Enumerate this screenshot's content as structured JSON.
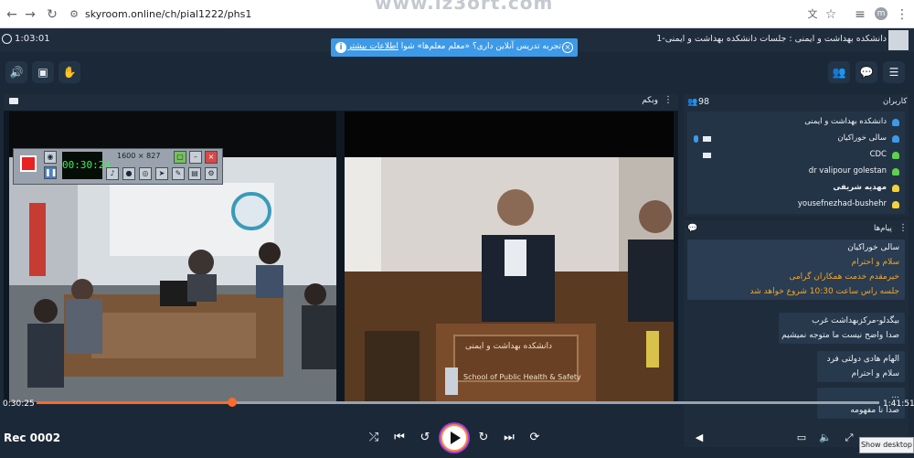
{
  "browser": {
    "url": "skyroom.online/ch/pial1222/phs1",
    "watermark": "www.lz3ort.com",
    "profile_initial": "m"
  },
  "app": {
    "timer": "1:03:01",
    "notice": {
      "text": "تجربه تدریس آنلاین داری؟ «معلم معلم‌ها» شوا",
      "link": "اطلاعات بیشتر"
    },
    "room_title": "دانشکده بهداشت و ایمنی : جلسات دانشکده بهداشت و ایمنی-1"
  },
  "video": {
    "title": "وبکم",
    "recorder": {
      "elapsed": "00:30:24",
      "size": "1600 × 827"
    }
  },
  "users": {
    "label": "کاربران",
    "count": "98",
    "items": [
      {
        "name": "دانشکده بهداشت و ایمنی",
        "color": "#3d9ae8",
        "mic": false,
        "cam": false
      },
      {
        "name": "سالی خوراکیان",
        "color": "#3d9ae8",
        "mic": true,
        "cam": true
      },
      {
        "name": "CDC",
        "color": "#5ed04e",
        "mic": false,
        "cam": true
      },
      {
        "name": "dr valipour golestan",
        "color": "#5ed04e",
        "mic": false,
        "cam": false
      },
      {
        "name": "مهدیه شریفی",
        "color": "#f2d23a",
        "mic": false,
        "cam": false
      },
      {
        "name": "yousefnezhad-bushehr",
        "color": "#f2d23a",
        "mic": false,
        "cam": false
      }
    ]
  },
  "messages": {
    "label": "پیام‌ها",
    "items": [
      {
        "author": "سالی خوراکیان",
        "lines": [
          "سلام و احترام",
          "خیرمقدم خدمت همکاران گرامی",
          "جلسه راس ساعت 10:30 شروع خواهد شد"
        ]
      },
      {
        "author": "بیگدلو-مرکزبهداشت غرب",
        "lines": [
          "صدا واضح نیست ما متوجه نمیشیم"
        ]
      },
      {
        "author": "الهام هادی دولتی فرد",
        "lines": [
          "سلام و احترام"
        ]
      },
      {
        "author": "...",
        "lines": [
          "صدا نا مفهومه"
        ]
      }
    ]
  },
  "playback": {
    "current": "0:30:25",
    "total": "1:41:51",
    "progress": 0.232,
    "rec_label": "Rec 0002",
    "tooltip": "Show desktop"
  },
  "colors": {
    "accent": "#3d9ae8",
    "progress": "#ff6a2a",
    "message_highlight": "#f5a524"
  }
}
